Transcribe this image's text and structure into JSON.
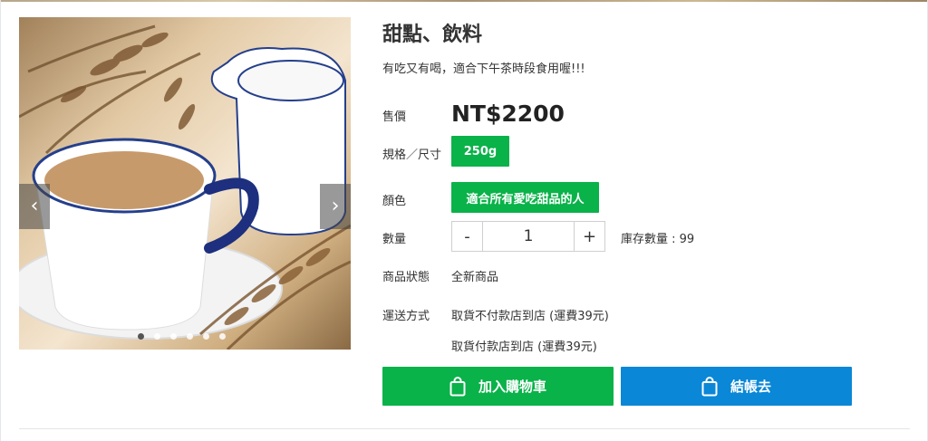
{
  "product": {
    "title": "甜點、飲料",
    "subtitle": "有吃又有喝，適合下午茶時段食用喔!!!",
    "price_label": "售價",
    "price": "NT$2200",
    "spec_label": "規格／尺寸",
    "spec_option": "250g",
    "color_label": "顏色",
    "color_option": "適合所有愛吃甜品的人",
    "qty_label": "數量",
    "qty_minus": "-",
    "qty_value": "1",
    "qty_plus": "+",
    "stock": "庫存數量 : 99",
    "status_label": "商品狀態",
    "status_value": "全新商品",
    "shipping_label": "運送方式",
    "shipping_options": [
      "取貨不付款店到店 (運費39元)",
      "取貨付款店到店 (運費39元)"
    ]
  },
  "gallery": {
    "prev_icon": "‹",
    "next_icon": "›",
    "dot_count": 6,
    "active_dot": 0
  },
  "actions": {
    "add_to_cart": "加入購物車",
    "checkout": "結帳去"
  },
  "colors": {
    "green": "#0ab24a",
    "blue": "#0a87d6"
  }
}
